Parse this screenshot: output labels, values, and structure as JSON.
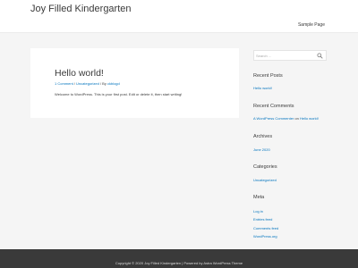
{
  "header": {
    "site_title": "Joy Filled Kindergarten",
    "nav": {
      "sample_page": "Sample Page"
    }
  },
  "post": {
    "title": "Hello world!",
    "meta": {
      "comments": "1 Comment",
      "sep1": " / ",
      "category": "Uncategorized",
      "by": " / By ",
      "author": "ckblogd"
    },
    "excerpt": "Welcome to WordPress. This is your first post. Edit or delete it, then start writing!"
  },
  "sidebar": {
    "search": {
      "placeholder": "Search ...",
      "icon": "search-icon"
    },
    "recent_posts": {
      "title": "Recent Posts",
      "items": [
        "Hello world!"
      ]
    },
    "recent_comments": {
      "title": "Recent Comments",
      "commenter": "A WordPress Commenter",
      "on": " on ",
      "post": "Hello world!"
    },
    "archives": {
      "title": "Archives",
      "items": [
        "June 2020"
      ]
    },
    "categories": {
      "title": "Categories",
      "items": [
        "Uncategorized"
      ]
    },
    "meta": {
      "title": "Meta",
      "items": [
        "Log in",
        "Entries feed",
        "Comments feed",
        "WordPress.org"
      ]
    }
  },
  "footer": {
    "text": "Copyright © 2020 Joy Filled Kindergarten | Powered by Astra WordPress Theme"
  },
  "colors": {
    "link": "#0274be",
    "text": "#3a3a3a",
    "background": "#f5f5f5",
    "footer_bg": "#3a3a3a"
  }
}
